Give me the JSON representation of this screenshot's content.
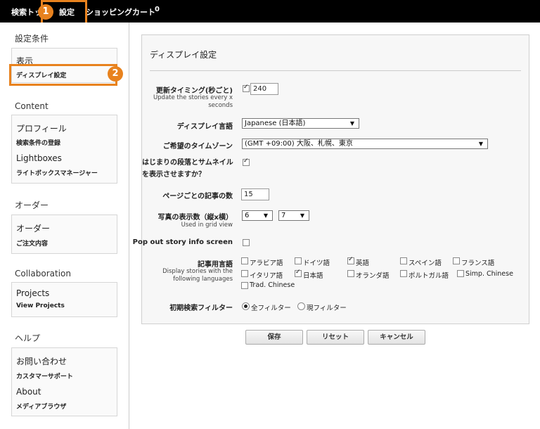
{
  "topbar": {
    "search_label": "検索トップ",
    "settings_label": "設定",
    "cart_label": "ショッピングカート",
    "cart_count": "0"
  },
  "annotations": {
    "badge1": "1",
    "badge2": "2",
    "color": "#e8821e"
  },
  "sidebar": {
    "sections": [
      {
        "title": "設定条件",
        "items": [
          {
            "heading": "表示",
            "links": [
              "ディスプレイ設定"
            ]
          }
        ]
      },
      {
        "title": "Content",
        "items": [
          {
            "heading": "プロフィール",
            "links": [
              "検索条件の登録"
            ]
          },
          {
            "heading": "Lightboxes",
            "links": [
              "ライトボックスマネージャー"
            ]
          }
        ]
      },
      {
        "title": "オーダー",
        "items": [
          {
            "heading": "オーダー",
            "links": [
              "ご注文内容"
            ]
          }
        ]
      },
      {
        "title": "Collaboration",
        "items": [
          {
            "heading": "Projects",
            "links": [
              "View Projects"
            ]
          }
        ]
      },
      {
        "title": "ヘルプ",
        "items": [
          {
            "heading": "お問い合わせ",
            "links": [
              "カスタマーサポート"
            ]
          },
          {
            "heading": "About",
            "links": [
              "メディアブラウザ"
            ]
          }
        ]
      }
    ]
  },
  "panel": {
    "title": "ディスプレイ設定",
    "refresh": {
      "label": "更新タイミング(秒ごと)",
      "sub": "Update the stories every x seconds",
      "checked": true,
      "value": "240"
    },
    "language": {
      "label": "ディスプレイ言語",
      "value": "Japanese (日本語)"
    },
    "timezone": {
      "label": "ご希望のタイムゾーン",
      "value": "(GMT +09:00) 大阪、札幌、東京"
    },
    "thumbnail": {
      "label": "はじまりの段落とサムネイルを表示させますか？",
      "checked": true
    },
    "per_page": {
      "label": "ページごとの記事の数",
      "value": "15"
    },
    "grid": {
      "label": "写真の表示数（縦x横）",
      "sub": "Used in grid view",
      "rows": "6",
      "cols": "7"
    },
    "popout": {
      "label": "Pop out story info screen",
      "checked": false
    },
    "article_lang": {
      "label": "記事用言語",
      "sub": "Display stories with the following languages",
      "options": [
        {
          "name": "アラビア語",
          "checked": false
        },
        {
          "name": "ドイツ語",
          "checked": false
        },
        {
          "name": "英語",
          "checked": true
        },
        {
          "name": "スペイン語",
          "checked": false
        },
        {
          "name": "フランス語",
          "checked": false
        },
        {
          "name": "イタリア語",
          "checked": false
        },
        {
          "name": "日本語",
          "checked": true
        },
        {
          "name": "オランダ語",
          "checked": false
        },
        {
          "name": "ポルトガル語",
          "checked": false
        },
        {
          "name": "Simp. Chinese",
          "checked": false
        },
        {
          "name": "Trad. Chinese",
          "checked": false
        }
      ]
    },
    "filter": {
      "label": "初期検索フィルター",
      "options": [
        "全フィルター",
        "現フィルター"
      ],
      "selected": 0
    }
  },
  "buttons": {
    "save": "保存",
    "reset": "リセット",
    "cancel": "キャンセル"
  }
}
